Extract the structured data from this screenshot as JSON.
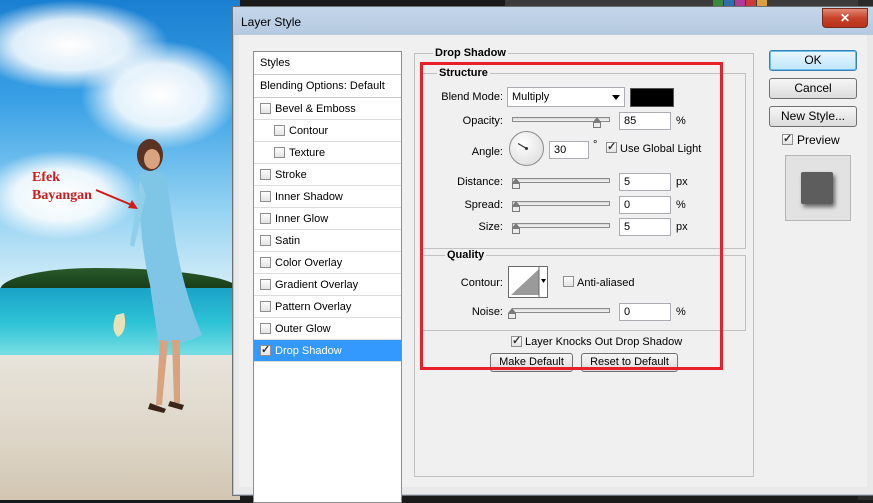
{
  "annotation": {
    "line1": "Efek",
    "line2": "Bayangan",
    "color": "#d11a1a"
  },
  "dialog": {
    "title": "Layer Style",
    "close_glyph": "✕"
  },
  "styles_panel": {
    "header": "Styles",
    "blending_options": "Blending Options: Default",
    "items": [
      {
        "label": "Bevel & Emboss",
        "checked": false,
        "indent": false
      },
      {
        "label": "Contour",
        "checked": false,
        "indent": true
      },
      {
        "label": "Texture",
        "checked": false,
        "indent": true
      },
      {
        "label": "Stroke",
        "checked": false,
        "indent": false
      },
      {
        "label": "Inner Shadow",
        "checked": false,
        "indent": false
      },
      {
        "label": "Inner Glow",
        "checked": false,
        "indent": false
      },
      {
        "label": "Satin",
        "checked": false,
        "indent": false
      },
      {
        "label": "Color Overlay",
        "checked": false,
        "indent": false
      },
      {
        "label": "Gradient Overlay",
        "checked": false,
        "indent": false
      },
      {
        "label": "Pattern Overlay",
        "checked": false,
        "indent": false
      },
      {
        "label": "Outer Glow",
        "checked": false,
        "indent": false
      },
      {
        "label": "Drop Shadow",
        "checked": true,
        "indent": false,
        "selected": true
      }
    ]
  },
  "drop_shadow": {
    "title": "Drop Shadow",
    "structure": {
      "title": "Structure",
      "blend_mode_label": "Blend Mode:",
      "blend_mode_value": "Multiply",
      "shadow_color": "#000000",
      "opacity_label": "Opacity:",
      "opacity_value": "85",
      "opacity_unit": "%",
      "opacity_level": 0.85,
      "angle_label": "Angle:",
      "angle_value": "30",
      "angle_unit": "°",
      "use_global_light_label": "Use Global Light",
      "use_global_light": true,
      "distance_label": "Distance:",
      "distance_value": "5",
      "distance_unit": "px",
      "spread_label": "Spread:",
      "spread_value": "0",
      "spread_unit": "%",
      "size_label": "Size:",
      "size_value": "5",
      "size_unit": "px"
    },
    "quality": {
      "title": "Quality",
      "contour_label": "Contour:",
      "anti_aliased_label": "Anti-aliased",
      "anti_aliased": false,
      "noise_label": "Noise:",
      "noise_value": "0",
      "noise_unit": "%"
    },
    "knockout_label": "Layer Knocks Out Drop Shadow",
    "knockout": true,
    "make_default": "Make Default",
    "reset_default": "Reset to Default"
  },
  "actions": {
    "ok": "OK",
    "cancel": "Cancel",
    "new_style": "New Style...",
    "preview_label": "Preview",
    "preview_checked": true
  },
  "colors": {
    "highlight": "#e8202a",
    "selection": "#3399ff"
  }
}
